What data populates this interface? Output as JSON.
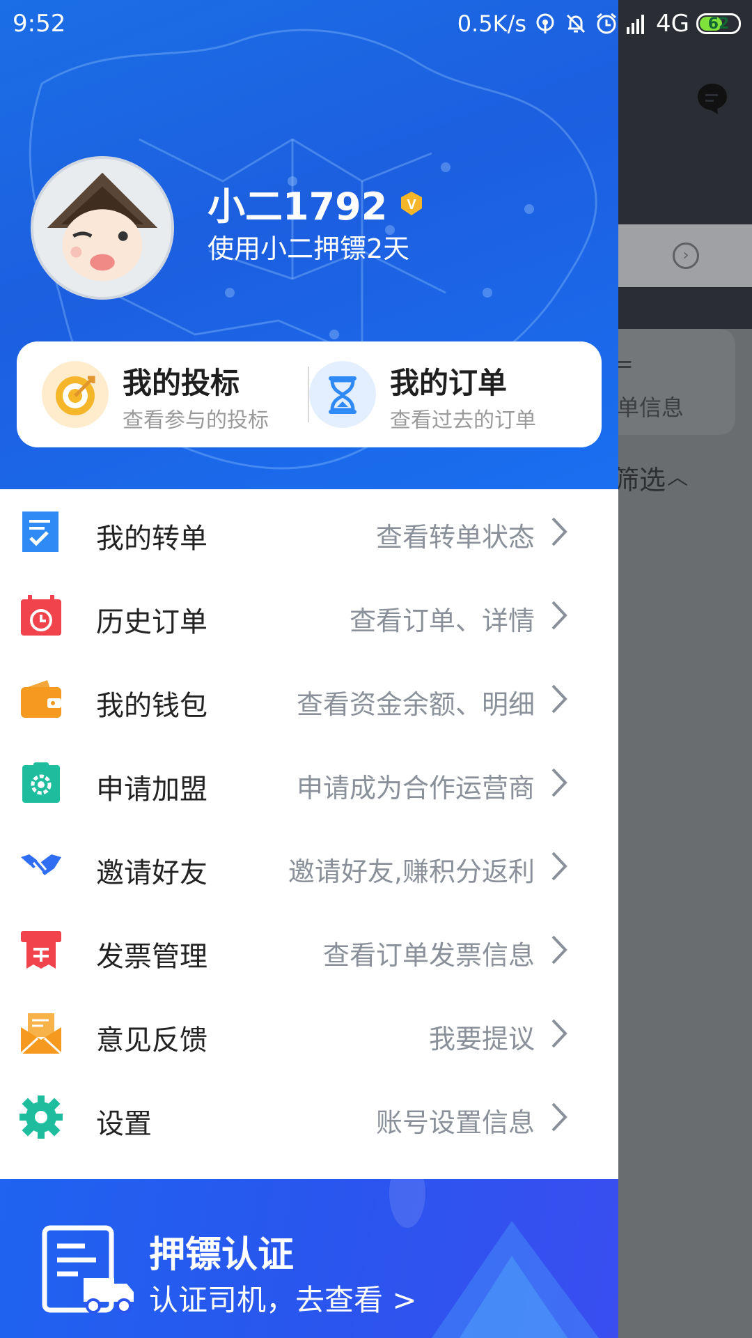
{
  "status_bar": {
    "time": "9:52",
    "net_speed": "0.5K/s",
    "network": "4G",
    "battery": "62",
    "battery_level": 0.62
  },
  "profile": {
    "username": "小二1792",
    "usage": "使用小二押镖2天",
    "avatar_icon": "cartoon-avatar",
    "badge_icon": "vip-badge-icon"
  },
  "quick_links": [
    {
      "title": "我的投标",
      "subtitle": "查看参与的投标",
      "icon": "target-icon"
    },
    {
      "title": "我的订单",
      "subtitle": "查看过去的订单",
      "icon": "hourglass-icon"
    }
  ],
  "menu": [
    {
      "label": "我的转单",
      "desc": "查看转单状态",
      "icon": "transfer-checklist-icon",
      "color": "#2f8af5"
    },
    {
      "label": "历史订单",
      "desc": "查看订单、详情",
      "icon": "calendar-clock-icon",
      "color": "#f0434b"
    },
    {
      "label": "我的钱包",
      "desc": "查看资金余额、明细",
      "icon": "wallet-icon",
      "color": "#f59a1f"
    },
    {
      "label": "申请加盟",
      "desc": "申请成为合作运营商",
      "icon": "join-gear-icon",
      "color": "#1dbd9e"
    },
    {
      "label": "邀请好友",
      "desc": "邀请好友,赚积分返利",
      "icon": "handshake-icon",
      "color": "#2f6df2"
    },
    {
      "label": "发票管理",
      "desc": "查看订单发票信息",
      "icon": "invoice-icon",
      "color": "#f0434b"
    },
    {
      "label": "意见反馈",
      "desc": "我要提议",
      "icon": "envelope-icon",
      "color": "#f59a1f"
    },
    {
      "label": "设置",
      "desc": "账号设置信息",
      "icon": "settings-gear-icon",
      "color": "#1dbd9e"
    }
  ],
  "banner": {
    "title": "押镖认证",
    "subtitle": "认证司机，去查看 >",
    "icon": "document-truck-icon"
  },
  "background": {
    "card_text": "单信息",
    "card_mark": "=",
    "filter_label": "筛选"
  },
  "colors": {
    "header_blue": "#1c64e8",
    "banner_blue": "#2a55ee",
    "overlay_gray": "#6a6d70"
  }
}
